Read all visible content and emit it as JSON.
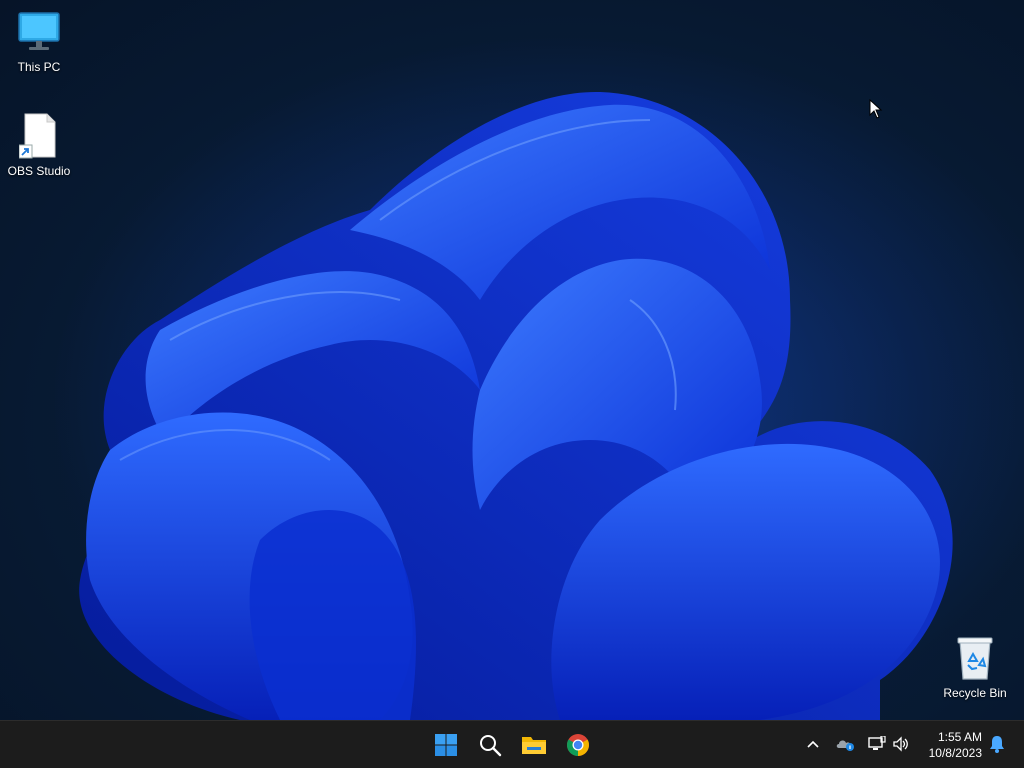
{
  "desktop": {
    "icons": [
      {
        "label": "This PC",
        "icon": "monitor-icon"
      },
      {
        "label": "OBS Studio",
        "icon": "file-shortcut-icon"
      },
      {
        "label": "Recycle Bin",
        "icon": "recycle-bin-icon"
      }
    ],
    "wallpaper": {
      "accent": "#1f5cff",
      "background": "#081d38"
    }
  },
  "taskbar": {
    "pinned": [
      {
        "name": "Start",
        "icon": "windows-start-icon"
      },
      {
        "name": "Search",
        "icon": "search-icon"
      },
      {
        "name": "File Explorer",
        "icon": "folder-icon"
      },
      {
        "name": "Google Chrome",
        "icon": "chrome-icon"
      }
    ],
    "tray": {
      "time": "1:55 AM",
      "date": "10/8/2023",
      "icons": [
        "chevron-up-icon",
        "onedrive-icon",
        "network-icon",
        "volume-icon",
        "notification-bell-icon"
      ]
    }
  }
}
